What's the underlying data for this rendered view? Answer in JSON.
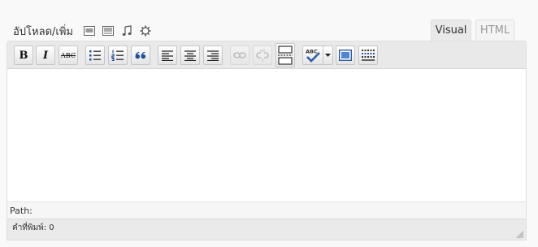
{
  "media": {
    "label": "อัปโหลด/เพิ่ม",
    "icons": [
      "image-icon",
      "video-icon",
      "audio-icon",
      "media-gear-icon"
    ]
  },
  "tabs": {
    "visual": "Visual",
    "html": "HTML"
  },
  "toolbar": {
    "bold": "B",
    "italic": "I",
    "strike": "ABC",
    "buttons": [
      "bold",
      "italic",
      "strikethrough",
      "bullet-list",
      "numbered-list",
      "blockquote",
      "align-left",
      "align-center",
      "align-right",
      "insert-link",
      "unlink",
      "insert-more",
      "spellcheck",
      "fullscreen",
      "kitchen-sink"
    ]
  },
  "path": {
    "label": "Path:"
  },
  "status": {
    "word_count": "คำที่พิมพ์: 0"
  },
  "colors": {
    "toolbar_bg": "#e9e9e9",
    "spell_accent": "#2a5db0"
  }
}
